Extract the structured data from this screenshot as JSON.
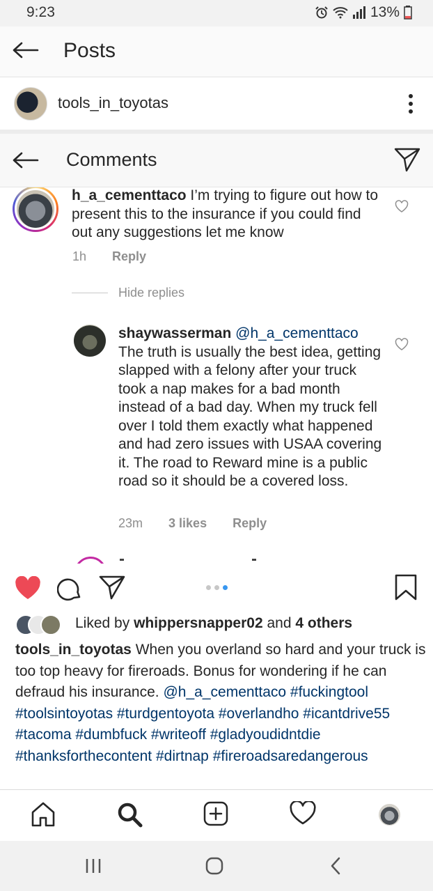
{
  "status_bar": {
    "time": "9:23",
    "battery": "13%"
  },
  "posts_header": {
    "title": "Posts"
  },
  "post_author": {
    "username": "tools_in_toyotas"
  },
  "comments_header": {
    "title": "Comments"
  },
  "comments": [
    {
      "username": "h_a_cementtaco",
      "text": "I’m trying to figure out how to present this to the insurance if you could find out any suggestions let me know",
      "time": "1h",
      "reply_label": "Reply"
    }
  ],
  "hide_replies_label": "Hide replies",
  "reply": {
    "username": "shaywasserman",
    "mention": "@h_a_cementtaco",
    "text": "The truth is usually the best idea, getting slapped with a felony after your truck took a nap makes for a bad month instead of a bad day. When my truck fell over I told them exactly what happened and had zero issues with USAA covering it. The road to Reward mine is a public road so it should be a covered loss.",
    "time": "23m",
    "likes": "3 likes",
    "reply_label": "Reply"
  },
  "likes": {
    "prefix": "Liked by",
    "user": "whippersnapper02",
    "and": "and",
    "others": "4 others"
  },
  "caption": {
    "username": "tools_in_toyotas",
    "text": "When you overland so hard and your truck is too top heavy for fireroads. Bonus for wondering if he can defraud his insurance.",
    "mention": "@h_a_cementtaco",
    "hashtags": "#fuckingtool #toolsintoyotas #turdgentoyota #overlandho #icantdrive55 #tacoma #dumbfuck #writeoff #gladyoudidntdie #thanksforthecontent #dirtnap #fireroadsaredangerous"
  },
  "colors": {
    "heart": "#ed4956",
    "link": "#003569",
    "muted": "#8e8e8e",
    "dot_active": "#3897f0"
  },
  "icons": [
    "back-arrow-icon",
    "more-vert-icon",
    "send-icon",
    "heart-icon",
    "comment-icon",
    "bookmark-icon",
    "home-icon",
    "search-icon",
    "new-post-icon",
    "activity-heart-icon",
    "profile-avatar",
    "recents-icon",
    "home-circle-icon",
    "system-back-icon"
  ]
}
